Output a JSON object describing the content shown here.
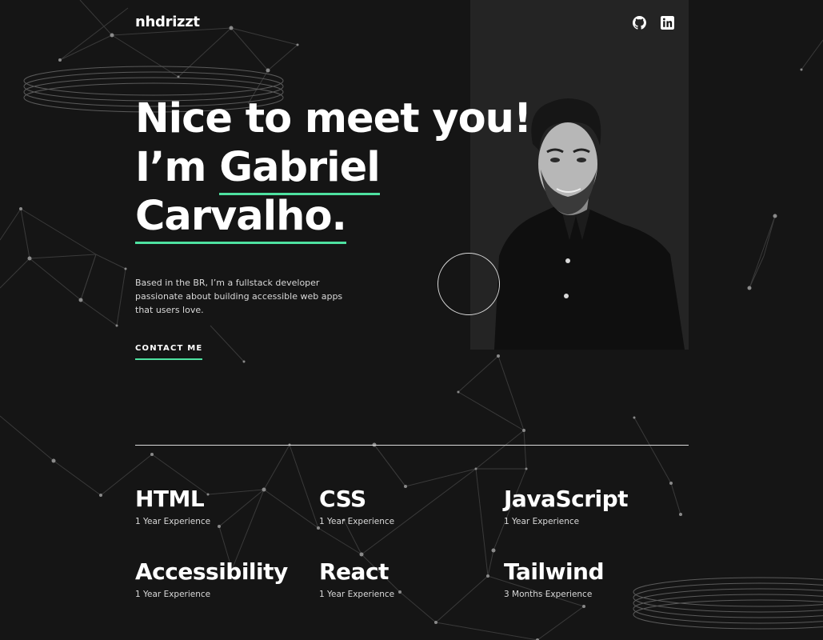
{
  "header": {
    "logo": "nhdrizzt",
    "social": [
      {
        "name": "GitHub",
        "icon": "github-icon"
      },
      {
        "name": "LinkedIn",
        "icon": "linkedin-icon"
      }
    ]
  },
  "hero": {
    "line1": "Nice to meet you!",
    "line2_prefix": "I’m ",
    "line2_highlight": "Gabriel",
    "line3_highlight": "Carvalho.",
    "description": "Based in the BR, I’m a fullstack developer passionate about building accessible web apps that users love.",
    "contact_label": "CONTACT ME"
  },
  "skills": [
    {
      "name": "HTML",
      "experience": "1 Year Experience"
    },
    {
      "name": "CSS",
      "experience": "1 Year Experience"
    },
    {
      "name": "JavaScript",
      "experience": "1 Year Experience"
    },
    {
      "name": "Accessibility",
      "experience": "1 Year Experience"
    },
    {
      "name": "React",
      "experience": "1 Year Experience"
    },
    {
      "name": "Tailwind",
      "experience": "3 Months Experience"
    }
  ],
  "colors": {
    "background": "#151515",
    "accent": "#4ee1a0",
    "panel": "#242424",
    "text_secondary": "#d9d9d9"
  }
}
